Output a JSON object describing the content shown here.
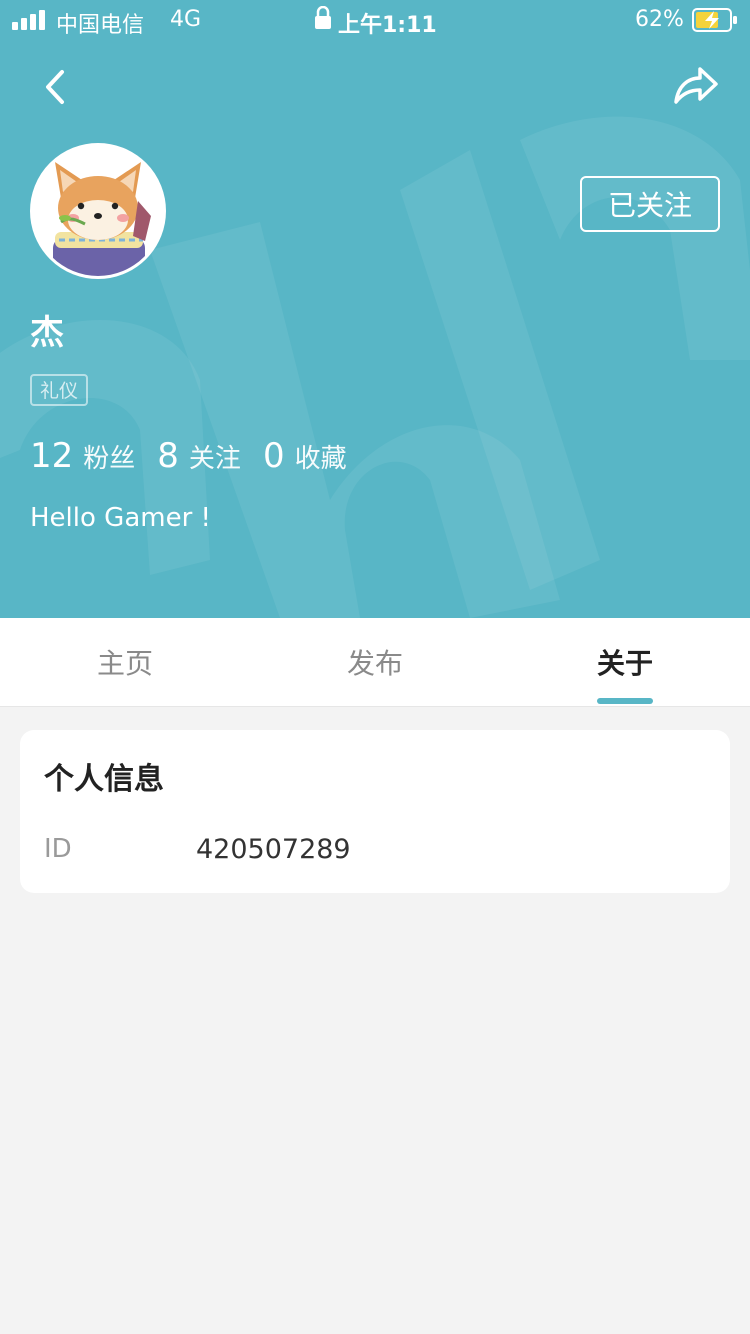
{
  "status_bar": {
    "carrier": "中国电信",
    "network": "4G",
    "time": "上午1:11",
    "battery": "62%"
  },
  "profile": {
    "name": "杰",
    "tag": "礼仪",
    "follow_button": "已关注",
    "stats": [
      {
        "value": "12",
        "label": "粉丝"
      },
      {
        "value": "8",
        "label": "关注"
      },
      {
        "value": "0",
        "label": "收藏"
      }
    ],
    "bio": "Hello Gamer !"
  },
  "tabs": [
    {
      "label": "主页"
    },
    {
      "label": "发布"
    },
    {
      "label": "关于"
    }
  ],
  "about": {
    "section_title": "个人信息",
    "id_label": "ID",
    "id_value": "420507289"
  },
  "colors": {
    "accent": "#58b6c6",
    "background": "#f3f3f3"
  },
  "icons": [
    "signal-icon",
    "lock-icon",
    "battery-icon",
    "back-icon",
    "share-icon"
  ]
}
